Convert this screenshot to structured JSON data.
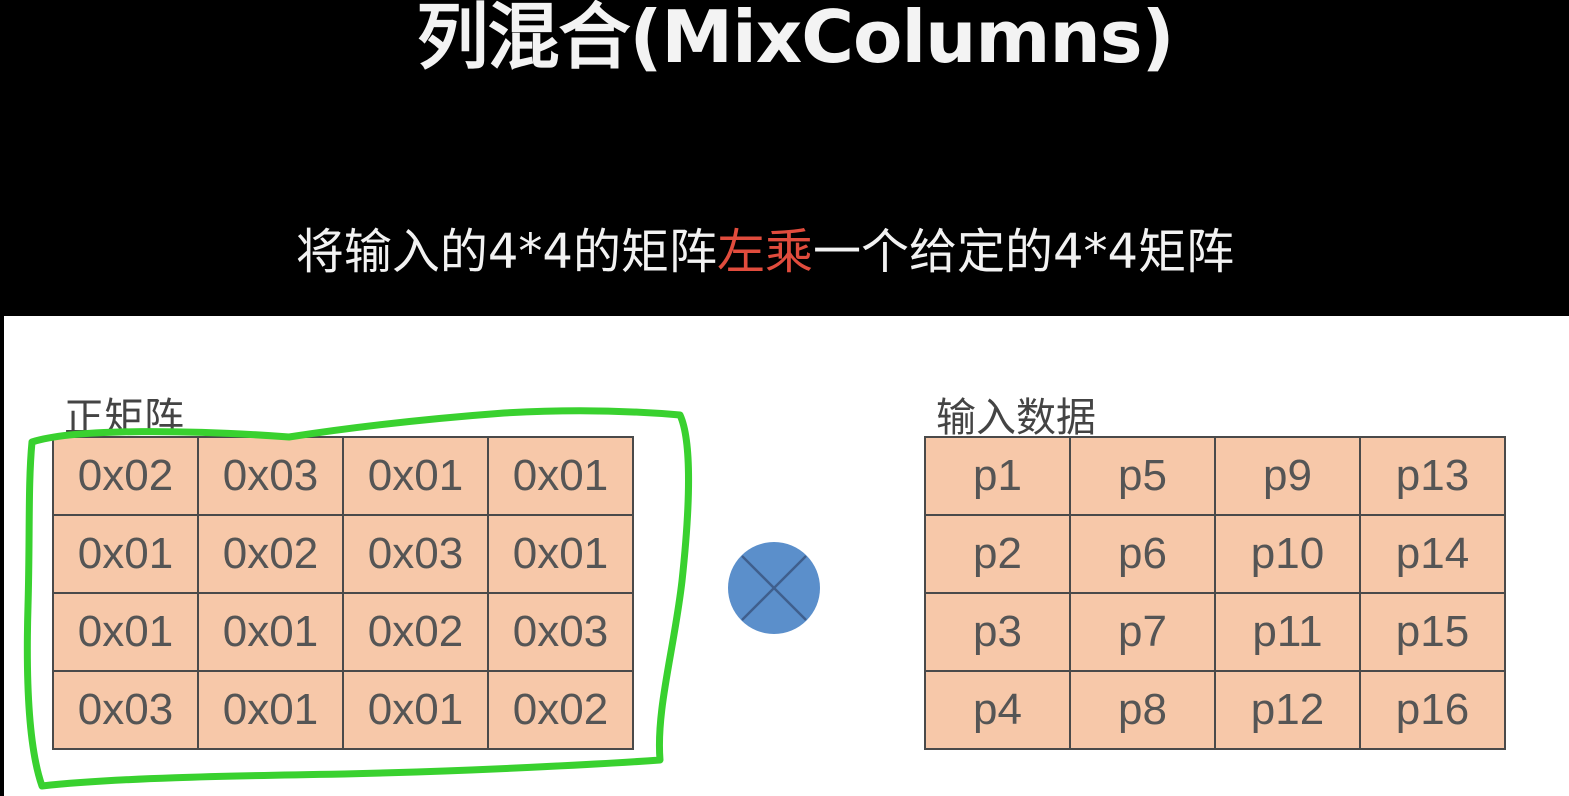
{
  "slide": {
    "title": "列混合(MixColumns)",
    "subtitle_prefix": "将输入的4*4的矩阵",
    "subtitle_accent": "左乘",
    "subtitle_suffix": "一个给定的4*4矩阵"
  },
  "left_matrix": {
    "label": "正矩阵",
    "rows": [
      [
        "0x02",
        "0x03",
        "0x01",
        "0x01"
      ],
      [
        "0x01",
        "0x02",
        "0x03",
        "0x01"
      ],
      [
        "0x01",
        "0x01",
        "0x02",
        "0x03"
      ],
      [
        "0x03",
        "0x01",
        "0x01",
        "0x02"
      ]
    ]
  },
  "right_matrix": {
    "label": "输入数据",
    "rows": [
      [
        "p1",
        "p5",
        "p9",
        "p13"
      ],
      [
        "p2",
        "p6",
        "p10",
        "p14"
      ],
      [
        "p3",
        "p7",
        "p11",
        "p15"
      ],
      [
        "p4",
        "p8",
        "p12",
        "p16"
      ]
    ]
  },
  "operator": {
    "icon": "circled-times-icon",
    "color": "#5b8fcb"
  },
  "annotation": {
    "color": "#39d12f"
  },
  "colors": {
    "background": "#000000",
    "title": "#f3f3f3",
    "subtitle": "#f2f2f2",
    "accent": "#e14c3d",
    "cell_fill": "#f7c8a9",
    "grid_line": "#4a4a4a",
    "cell_text": "#555555"
  }
}
